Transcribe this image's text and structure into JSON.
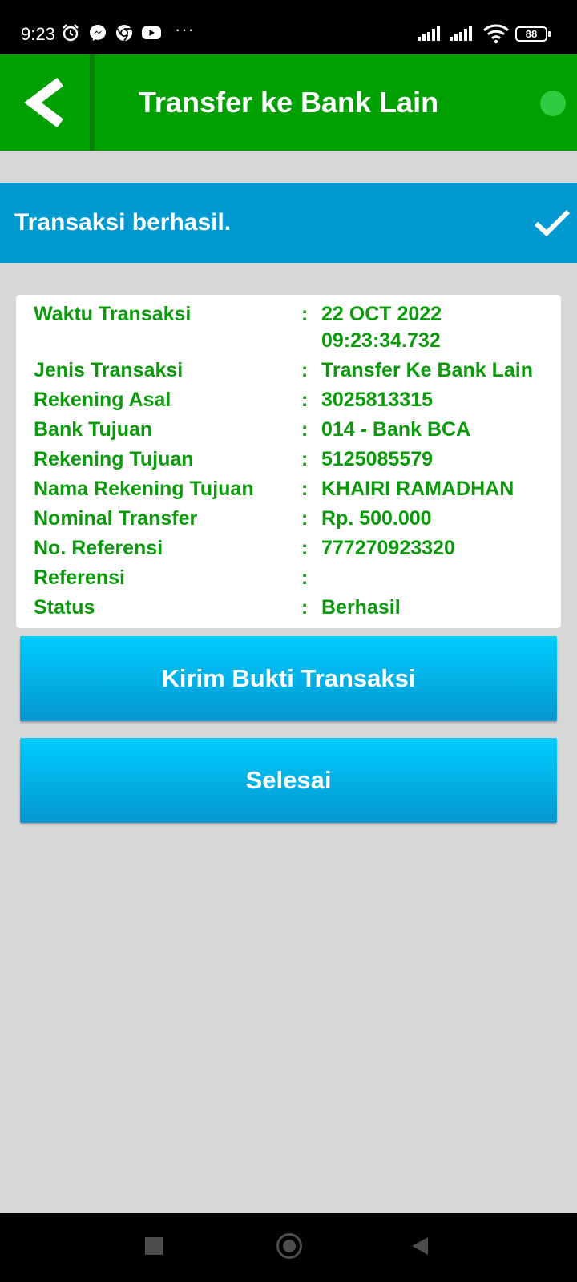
{
  "status_bar": {
    "time": "9:23",
    "battery": "88",
    "icons": [
      "alarm-icon",
      "messenger-icon",
      "chrome-icon",
      "youtube-icon",
      "more-icon",
      "signal-icon",
      "signal-icon",
      "wifi-icon",
      "battery-icon"
    ]
  },
  "header": {
    "title": "Transfer ke Bank Lain",
    "back_icon": "chevron-left-icon",
    "indicator_color": "#2ecc40"
  },
  "banner": {
    "text": "Transaksi berhasil.",
    "icon": "check-icon"
  },
  "details": [
    {
      "label": "Waktu Transaksi",
      "separator": ":",
      "value": "22 OCT 2022\n09:23:34.732"
    },
    {
      "label": "Jenis Transaksi",
      "separator": ":",
      "value": "Transfer Ke Bank Lain"
    },
    {
      "label": "Rekening Asal",
      "separator": ":",
      "value": "3025813315"
    },
    {
      "label": "Bank Tujuan",
      "separator": ":",
      "value": "014 - Bank BCA"
    },
    {
      "label": "Rekening Tujuan",
      "separator": ":",
      "value": "5125085579"
    },
    {
      "label": "Nama Rekening Tujuan",
      "separator": ":",
      "value": "KHAIRI RAMADHAN"
    },
    {
      "label": "Nominal Transfer",
      "separator": ":",
      "value": "Rp. 500.000"
    },
    {
      "label": "No. Referensi",
      "separator": ":",
      "value": "777270923320"
    },
    {
      "label": "Referensi",
      "separator": ":",
      "value": ""
    },
    {
      "label": "Status",
      "separator": ":",
      "value": "Berhasil"
    }
  ],
  "buttons": {
    "send_proof": "Kirim Bukti Transaksi",
    "done": "Selesai"
  },
  "colors": {
    "header_green": "#00a000",
    "banner_blue": "#0099d0",
    "detail_text_green": "#0b9a0b",
    "button_blue": "#00c4f5",
    "background_gray": "#d7d7d7"
  },
  "nav_bar": {
    "icons": [
      "recents-icon",
      "home-icon",
      "back-icon"
    ]
  }
}
